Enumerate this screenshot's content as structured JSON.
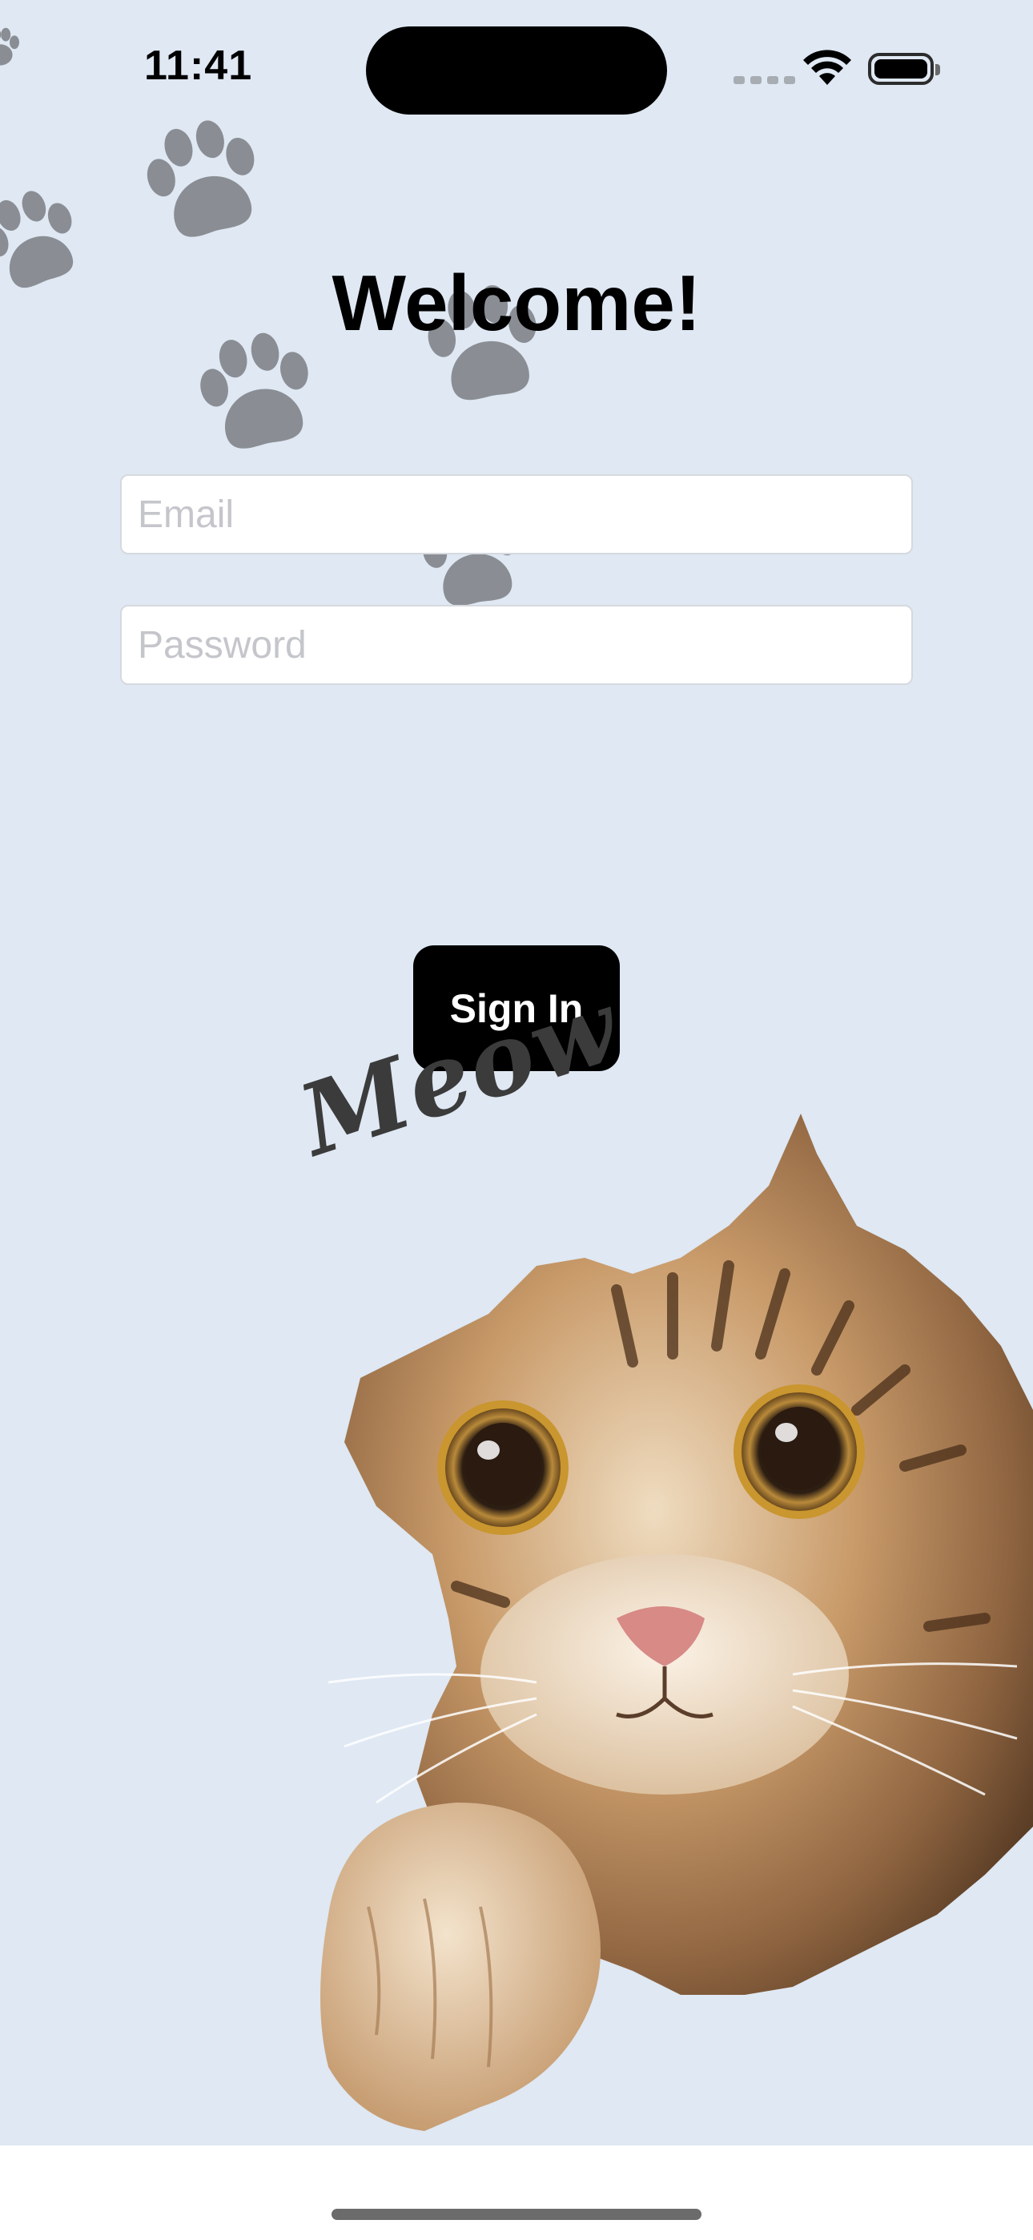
{
  "status_bar": {
    "time": "11:41",
    "signal_icon": "cellular-signal-icon",
    "wifi_icon": "wifi-icon",
    "battery_icon": "battery-full-icon"
  },
  "login": {
    "title": "Welcome!",
    "email_placeholder": "Email",
    "email_value": "",
    "password_placeholder": "Password",
    "password_value": "",
    "sign_in_label": "Sign In"
  },
  "decoration": {
    "logo_text": "Meow",
    "paw_icon": "paw-print-icon",
    "illustration": "peeking-cat-image",
    "paw_color": "#8a8e94"
  },
  "colors": {
    "background": "#dfe8f3",
    "button": "#000000",
    "button_text": "#ffffff"
  }
}
